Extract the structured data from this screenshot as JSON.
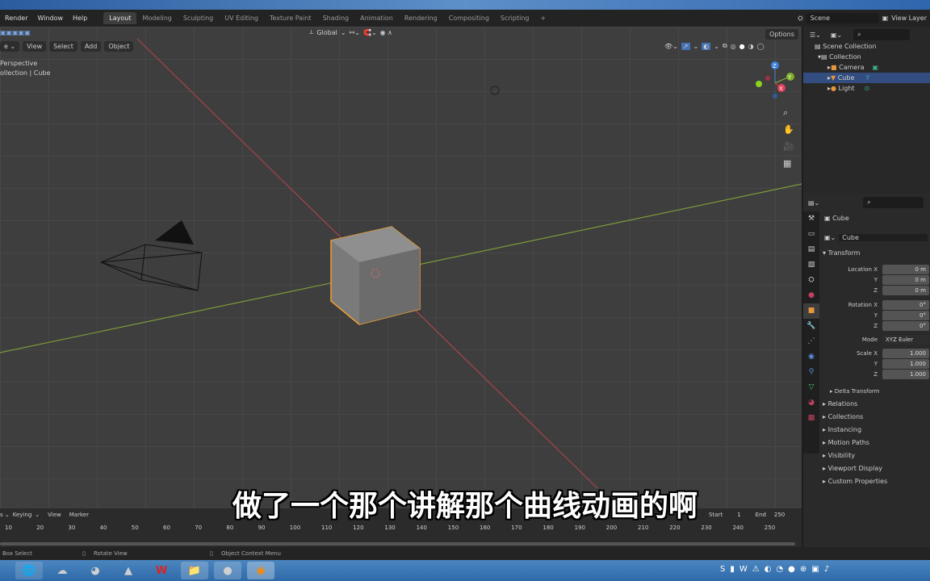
{
  "topbar": {
    "menus": [
      "Render",
      "Window",
      "Help"
    ],
    "workspaces": [
      "Layout",
      "Modeling",
      "Sculpting",
      "UV Editing",
      "Texture Paint",
      "Shading",
      "Animation",
      "Rendering",
      "Compositing",
      "Scripting"
    ],
    "scene": "Scene",
    "view_layer": "View Layer"
  },
  "viewport": {
    "transform_orientation": "Global",
    "menus": [
      "View",
      "Select",
      "Add",
      "Object"
    ],
    "options": "Options",
    "info_line1": "Perspective",
    "info_line2": "ollection | Cube",
    "gizmo": {
      "z": "Z",
      "y": "Y",
      "x": "X"
    }
  },
  "outliner": {
    "root": "Scene Collection",
    "collection": "Collection",
    "items": [
      "Camera",
      "Cube",
      "Light"
    ]
  },
  "properties": {
    "object_name": "Cube",
    "datablock": "Cube",
    "transform": "Transform",
    "location": {
      "label": "Location X",
      "x": "0 m",
      "y": "0 m",
      "z": "0 m"
    },
    "rotation": {
      "label": "Rotation X",
      "x": "0°",
      "y": "0°",
      "z": "0°"
    },
    "mode": {
      "label": "Mode",
      "value": "XYZ Euler"
    },
    "scale": {
      "label": "Scale X",
      "x": "1.000",
      "y": "1.000",
      "z": "1.000"
    },
    "axis": {
      "y": "Y",
      "z": "Z"
    },
    "delta": "Delta Transform",
    "panels": [
      "Relations",
      "Collections",
      "Instancing",
      "Motion Paths",
      "Visibility",
      "Viewport Display",
      "Custom Properties"
    ]
  },
  "timeline": {
    "menus": [
      "Keying",
      "View",
      "Marker"
    ],
    "start_label": "Start",
    "start": "1",
    "end_label": "End",
    "end": "250",
    "ticks": [
      "10",
      "20",
      "30",
      "40",
      "50",
      "60",
      "70",
      "80",
      "90",
      "100",
      "110",
      "120",
      "130",
      "140",
      "150",
      "160",
      "170",
      "180",
      "190",
      "200",
      "210",
      "220",
      "230",
      "240",
      "250"
    ]
  },
  "status": {
    "box_select": "Box Select",
    "rotate_view": "Rotate View",
    "context_menu": "Object Context Menu"
  },
  "subtitle": "做了一个那个讲解那个曲线动画的啊"
}
